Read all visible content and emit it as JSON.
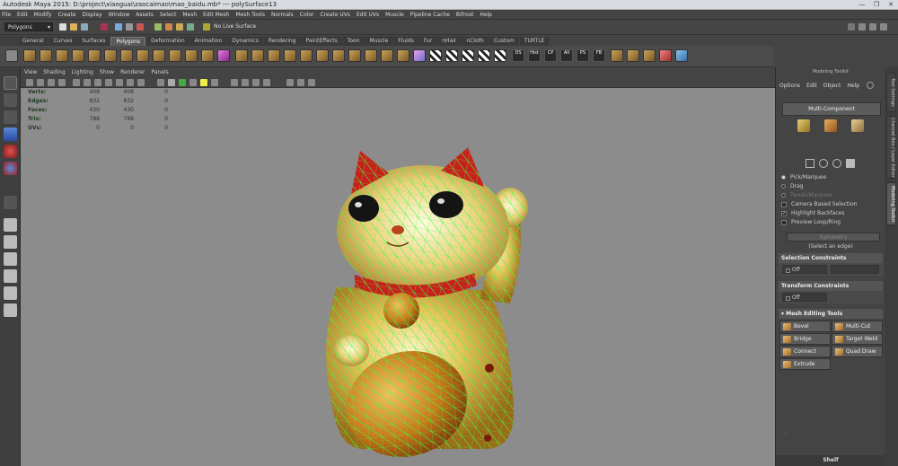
{
  "window": {
    "title": "Autodesk Maya 2015: D:\\project\\xiaoguai\\zaocaimao\\mao_baidu.mb*   ---   polySurface13",
    "minimize": "—",
    "maximize": "❐",
    "close": "✕"
  },
  "menubar": [
    "File",
    "Edit",
    "Modify",
    "Create",
    "Display",
    "Window",
    "Assets",
    "Select",
    "Mesh",
    "Edit Mesh",
    "Mesh Tools",
    "Normals",
    "Color",
    "Create UVs",
    "Edit UVs",
    "Muscle",
    "Pipeline Cache",
    "Bifrost",
    "Help"
  ],
  "statusline": {
    "mode": "Polygons",
    "live_surface": "No Live Surface"
  },
  "shelf_tabs": [
    "General",
    "Curves",
    "Surfaces",
    "Polygons",
    "Deformation",
    "Animation",
    "Dynamics",
    "Rendering",
    "PaintEffects",
    "Toon",
    "Muscle",
    "Fluids",
    "Fur",
    "nHair",
    "nCloth",
    "Custom",
    "TURTLE"
  ],
  "shelf_active": "Polygons",
  "shelf_labels": [
    "DS",
    "Hist",
    "CP",
    "All",
    "PS",
    "FB"
  ],
  "panel_menu": [
    "View",
    "Shading",
    "Lighting",
    "Show",
    "Renderer",
    "Panels"
  ],
  "hud": [
    {
      "label": "Verts:",
      "a": "408",
      "b": "408",
      "c": "0"
    },
    {
      "label": "Edges:",
      "a": "832",
      "b": "832",
      "c": "0"
    },
    {
      "label": "Faces:",
      "a": "430",
      "b": "430",
      "c": "0"
    },
    {
      "label": "Tris:",
      "a": "788",
      "b": "788",
      "c": "0"
    },
    {
      "label": "UVs:",
      "a": "0",
      "b": "0",
      "c": "0"
    }
  ],
  "modeling_toolkit": {
    "title": "Modeling Toolkit",
    "menu": [
      "Options",
      "Edit",
      "Object",
      "Help"
    ],
    "multi_component": "Multi-Component",
    "options": [
      {
        "label": "Pick/Marquee",
        "type": "radio",
        "on": true,
        "dim": false
      },
      {
        "label": "Drag",
        "type": "radio",
        "on": false,
        "dim": false
      },
      {
        "label": "Tweak/Marquee",
        "type": "radio",
        "on": false,
        "dim": true
      },
      {
        "label": "Camera Based Selection",
        "type": "check",
        "on": false,
        "dim": false
      },
      {
        "label": "Highlight Backfaces",
        "type": "check",
        "on": true,
        "dim": false
      },
      {
        "label": "Preview Loop/Ring",
        "type": "check",
        "on": false,
        "dim": false
      }
    ],
    "symmetry": "Symmetry",
    "select_hint": "(Select an edge)",
    "selection_constraints": "Selection Constraints",
    "sel_off": "Off",
    "transform_constraints": "Transform Constraints",
    "trans_off": "Off",
    "mesh_editing_tools": "Mesh Editing Tools",
    "tools": [
      "Bevel",
      "Multi-Cut",
      "Bridge",
      "Target Weld",
      "Connect",
      "Quad Draw",
      "Extrude"
    ],
    "shelf": "Shelf"
  },
  "side_tabs": [
    "Tool Settings",
    "Channel Box / Layer Editor",
    "Modeling Toolkit"
  ],
  "colors": {
    "wire": "#3cff3c",
    "gold": "#e2b23a",
    "red": "#c8201c"
  }
}
